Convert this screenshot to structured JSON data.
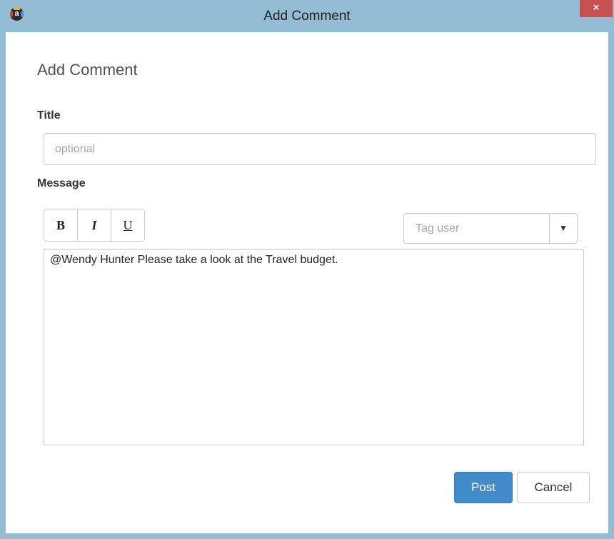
{
  "window": {
    "title": "Add Comment",
    "close_glyph": "×",
    "app_icon_letter": "a",
    "frame_color": "#95bcd5",
    "close_color": "#c75050"
  },
  "dialog": {
    "heading": "Add Comment",
    "title_label": "Title",
    "title_placeholder": "optional",
    "title_value": "",
    "message_label": "Message",
    "message_value": "@Wendy Hunter Please take a look at the Travel budget."
  },
  "toolbar": {
    "bold_label": "B",
    "italic_label": "I",
    "underline_label": "U",
    "bold_icon": "bold-icon",
    "italic_icon": "italic-icon",
    "underline_icon": "underline-icon"
  },
  "tag_user": {
    "placeholder": "Tag user",
    "caret_glyph": "▼",
    "caret_icon": "caret-down-icon"
  },
  "actions": {
    "post_label": "Post",
    "cancel_label": "Cancel",
    "primary_color": "#428bca"
  }
}
